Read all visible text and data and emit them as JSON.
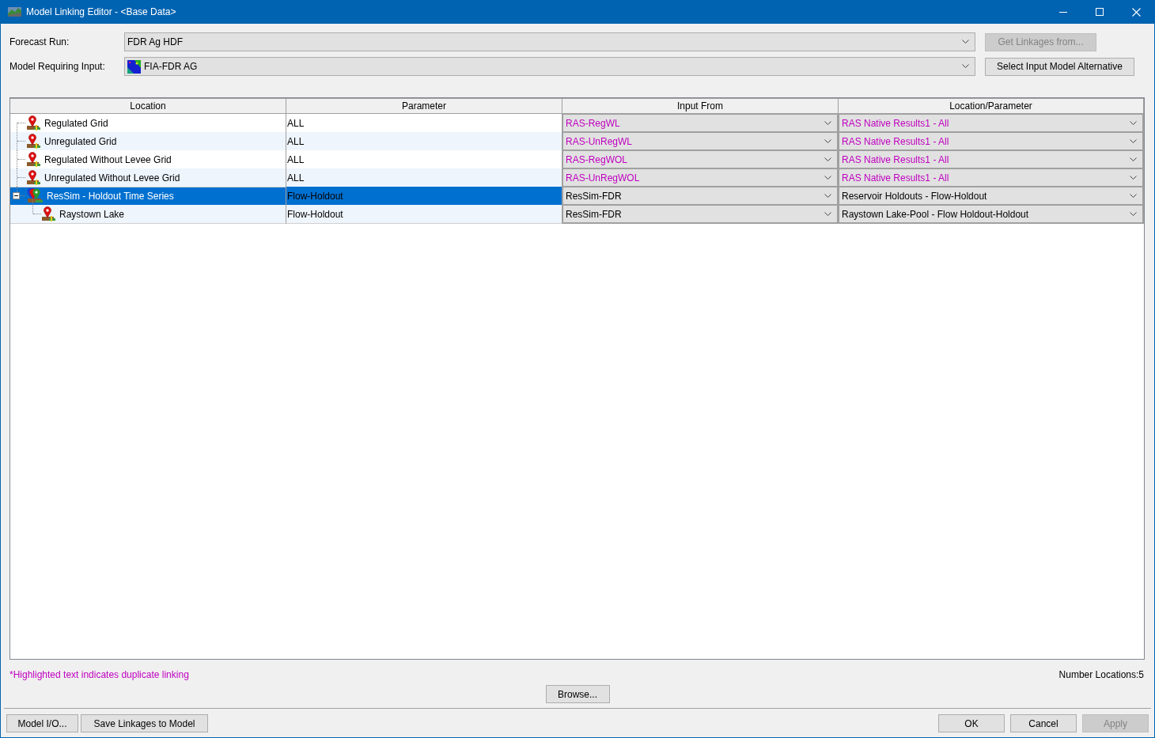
{
  "window": {
    "title": "Model Linking Editor - <Base Data>"
  },
  "forecast_run": {
    "label": "Forecast Run:",
    "value": "FDR Ag HDF"
  },
  "get_linkages_button": {
    "label": "Get Linkages from...",
    "disabled": true
  },
  "model_requiring_input": {
    "label": "Model Requiring Input:",
    "value": "FIA-FDR AG"
  },
  "select_alternative_button": {
    "label": "Select Input Model Alternative",
    "disabled": false
  },
  "table": {
    "columns": [
      "Location",
      "Parameter",
      "Input From",
      "Location/Parameter"
    ],
    "rows": [
      {
        "kind": "pin",
        "location": "Regulated Grid",
        "parameter": "ALL",
        "input_from": "RAS-RegWL",
        "location_parameter": "RAS Native Results1 - All",
        "duplicate": true,
        "selected": false
      },
      {
        "kind": "pin",
        "location": "Unregulated Grid",
        "parameter": "ALL",
        "input_from": "RAS-UnRegWL",
        "location_parameter": "RAS Native Results1 - All",
        "duplicate": true,
        "selected": false
      },
      {
        "kind": "pin",
        "location": "Regulated Without Levee Grid",
        "parameter": "ALL",
        "input_from": "RAS-RegWOL",
        "location_parameter": "RAS Native Results1 - All",
        "duplicate": true,
        "selected": false
      },
      {
        "kind": "pin",
        "location": "Unregulated Without Levee Grid",
        "parameter": "ALL",
        "input_from": "RAS-UnRegWOL",
        "location_parameter": "RAS Native Results1 - All",
        "duplicate": true,
        "selected": false
      },
      {
        "kind": "group",
        "location": "ResSim - Holdout Time Series",
        "parameter": "Flow-Holdout",
        "input_from": "ResSim-FDR",
        "location_parameter": "Reservoir Holdouts - Flow-Holdout",
        "duplicate": false,
        "selected": true,
        "expanded": true,
        "children": [
          {
            "kind": "pin",
            "location": "Raystown Lake",
            "parameter": "Flow-Holdout",
            "input_from": "ResSim-FDR",
            "location_parameter": "Raystown Lake-Pool - Flow Holdout-Holdout",
            "duplicate": false,
            "selected": false
          }
        ]
      }
    ]
  },
  "note": "*Highlighted text indicates duplicate linking",
  "number_locations": "Number Locations:5",
  "browse_button": {
    "label": "Browse...",
    "disabled": false
  },
  "bottom_left_buttons": [
    {
      "label": "Model I/O...",
      "disabled": false
    },
    {
      "label": "Save Linkages to Model",
      "disabled": false
    }
  ],
  "bottom_right_buttons": [
    {
      "label": "OK",
      "disabled": false
    },
    {
      "label": "Cancel",
      "disabled": false
    },
    {
      "label": "Apply",
      "disabled": true
    }
  ]
}
